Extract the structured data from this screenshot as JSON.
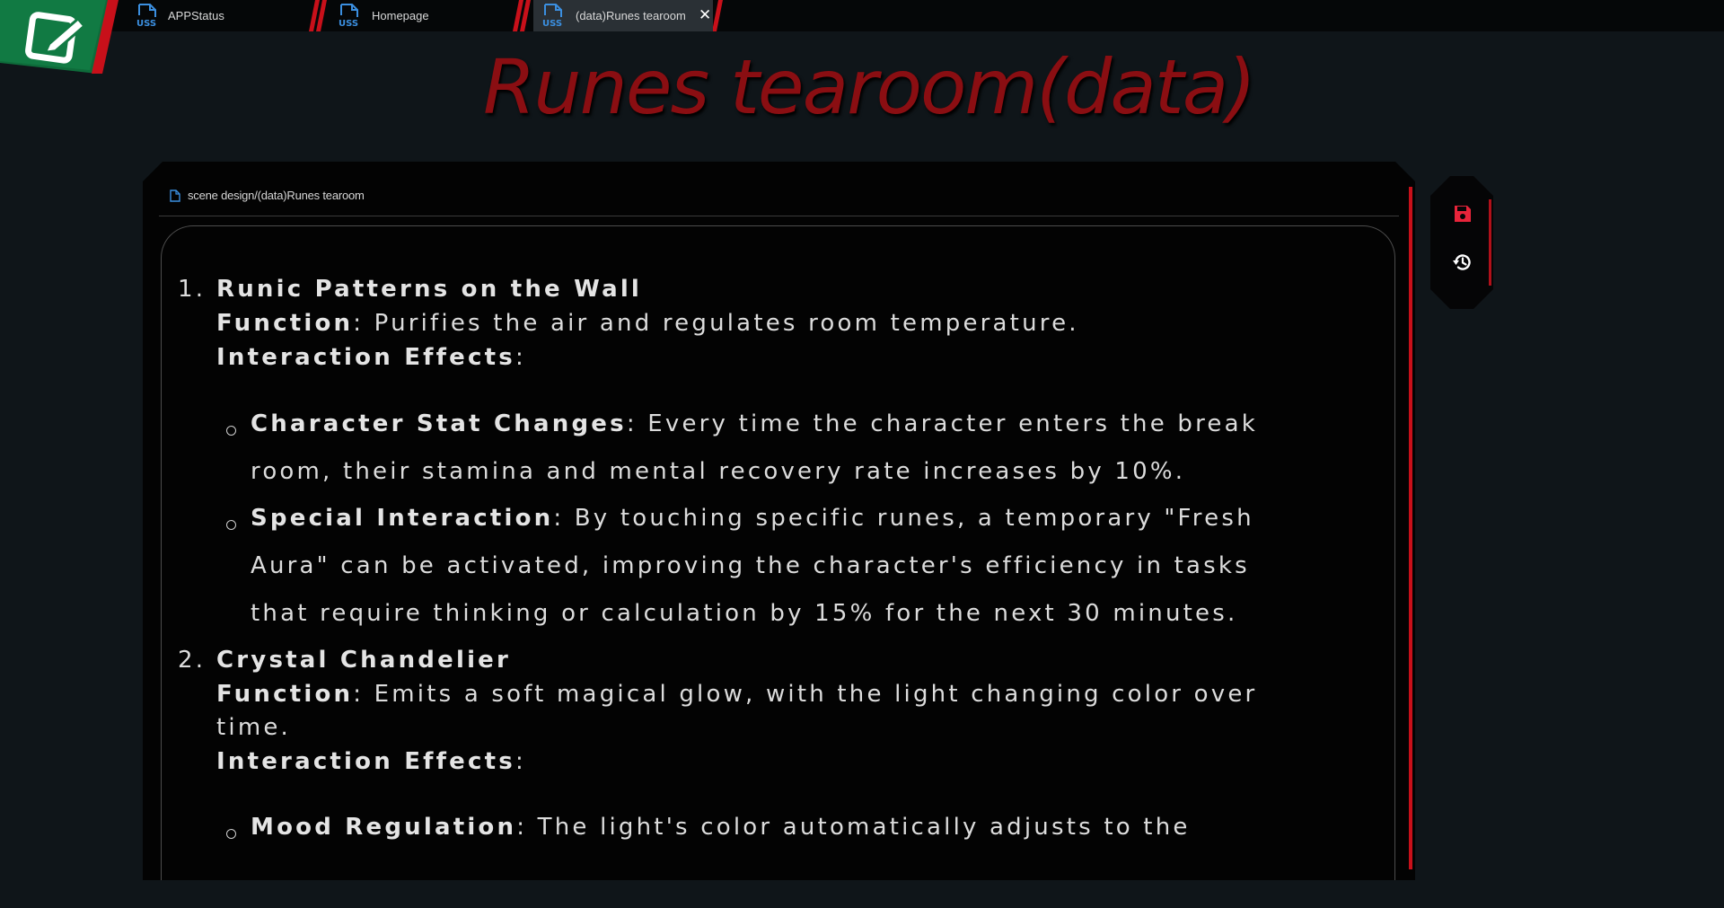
{
  "tabs": [
    {
      "label": "APPStatus",
      "icon": "uss-file-icon",
      "active": false
    },
    {
      "label": "Homepage",
      "icon": "uss-file-icon",
      "active": false
    },
    {
      "label": "(data)Runes tearoom",
      "icon": "uss-file-icon",
      "active": true,
      "close": "✕"
    }
  ],
  "title": "Runes tearoom(data)",
  "path": "scene design/(data)Runes tearoom",
  "colors": {
    "accent": "#c8101a",
    "title": "#8a0e12",
    "background": "#0f1519",
    "icon_blue": "#3b8fe0"
  },
  "doc": {
    "item1": {
      "num": "1.",
      "heading": "Runic Patterns on the Wall",
      "function_label": "Function",
      "function_text": ": Purifies the air and regulates room temperature.",
      "effects_label": "Interaction Effects",
      "effects_colon": ":",
      "bullets": [
        {
          "label": "Character Stat Changes",
          "line1": ": Every time the character enters the break",
          "line2": "room, their stamina and mental recovery rate increases by 10%."
        },
        {
          "label": "Special Interaction",
          "line1": ": By touching specific runes, a temporary \"Fresh",
          "line2": "Aura\" can be activated, improving the character's efficiency in tasks",
          "line3": "that require thinking or calculation by 15% for the next 30 minutes."
        }
      ]
    },
    "item2": {
      "num": "2.",
      "heading": "Crystal Chandelier",
      "function_label": "Function",
      "function_text": ": Emits a soft magical glow, with the light changing color over",
      "function_text2": "time.",
      "effects_label": "Interaction Effects",
      "effects_colon": ":",
      "bullets": [
        {
          "label": "Mood Regulation",
          "line1": ": The light's color automatically adjusts to the"
        }
      ]
    }
  },
  "toolbar": {
    "save_icon": "save-icon",
    "history_icon": "history-icon"
  }
}
